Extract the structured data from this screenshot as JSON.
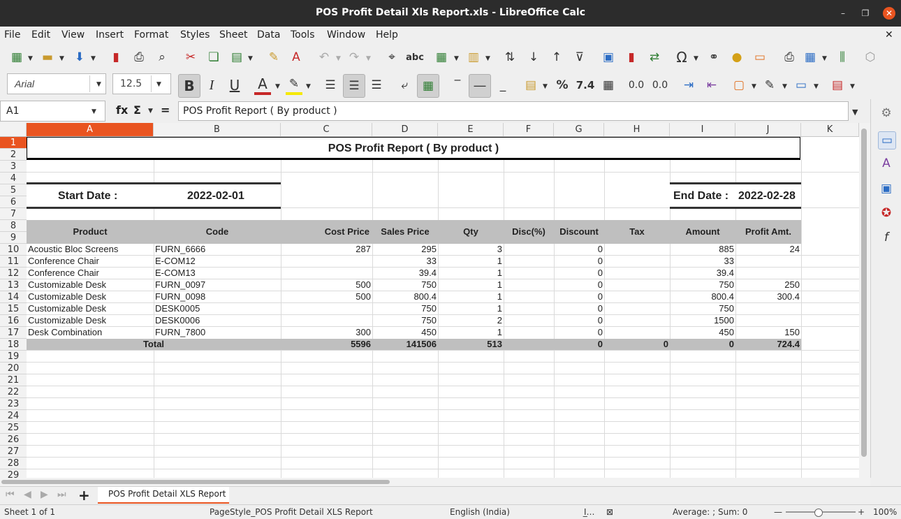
{
  "window": {
    "title": "POS Profit Detail Xls Report.xls - LibreOffice Calc"
  },
  "menu": [
    "File",
    "Edit",
    "View",
    "Insert",
    "Format",
    "Styles",
    "Sheet",
    "Data",
    "Tools",
    "Window",
    "Help"
  ],
  "formatting": {
    "font_name": "Arial",
    "font_size": "12.5"
  },
  "formula_bar": {
    "cell_ref": "A1",
    "content": "POS Profit Report ( By product )",
    "fx": "fx",
    "sum": "Σ",
    "equals": "="
  },
  "columns": [
    "A",
    "B",
    "C",
    "D",
    "E",
    "F",
    "G",
    "H",
    "I",
    "J",
    "K"
  ],
  "rows": [
    "1",
    "2",
    "3",
    "4",
    "5",
    "6",
    "7",
    "8",
    "9",
    "10",
    "11",
    "12",
    "13",
    "14",
    "15",
    "16",
    "17",
    "18",
    "19",
    "20",
    "21",
    "22",
    "23",
    "24",
    "25",
    "26",
    "27",
    "28",
    "29"
  ],
  "report": {
    "title": "POS Profit Report ( By product )",
    "start_label": "Start Date :",
    "start_value": "2022-02-01",
    "end_label": "End Date :",
    "end_value": "2022-02-28",
    "headers": [
      "Product",
      "Code",
      "Cost Price",
      "Sales Price",
      "Qty",
      "Disc(%)",
      "Discount",
      "Tax",
      "Amount",
      "Profit Amt."
    ],
    "lines": [
      [
        "Acoustic Bloc Screens",
        "FURN_6666",
        "287",
        "295",
        "3",
        "",
        "0",
        "",
        "885",
        "24"
      ],
      [
        "Conference Chair",
        "E-COM12",
        "",
        "33",
        "1",
        "",
        "0",
        "",
        "33",
        ""
      ],
      [
        "Conference Chair",
        "E-COM13",
        "",
        "39.4",
        "1",
        "",
        "0",
        "",
        "39.4",
        ""
      ],
      [
        "Customizable Desk",
        "FURN_0097",
        "500",
        "750",
        "1",
        "",
        "0",
        "",
        "750",
        "250"
      ],
      [
        "Customizable Desk",
        "FURN_0098",
        "500",
        "800.4",
        "1",
        "",
        "0",
        "",
        "800.4",
        "300.4"
      ],
      [
        "Customizable Desk",
        "DESK0005",
        "",
        "750",
        "1",
        "",
        "0",
        "",
        "750",
        ""
      ],
      [
        "Customizable Desk",
        "DESK0006",
        "",
        "750",
        "2",
        "",
        "0",
        "",
        "1500",
        ""
      ],
      [
        "Desk Combination",
        "FURN_7800",
        "300",
        "450",
        "1",
        "",
        "0",
        "",
        "450",
        "150"
      ]
    ],
    "total": {
      "label": "Total",
      "cost": "5596",
      "sales": "141506",
      "qty": "513",
      "discount": "0",
      "tax": "0",
      "amount": "0",
      "profit": "724.4"
    }
  },
  "sheet_tab": {
    "name": "POS Profit Detail XLS Report",
    "add": "+"
  },
  "status": {
    "sheet": "Sheet 1 of 1",
    "page_style": "PageStyle_POS Profit Detail XLS Report",
    "language": "English (India)",
    "selection": "Average: ; Sum: 0",
    "zoom": "100%"
  },
  "colors": {
    "accent": "#e95420",
    "header_fill": "#bfbfbf",
    "titlebar": "#2c2c2c"
  }
}
